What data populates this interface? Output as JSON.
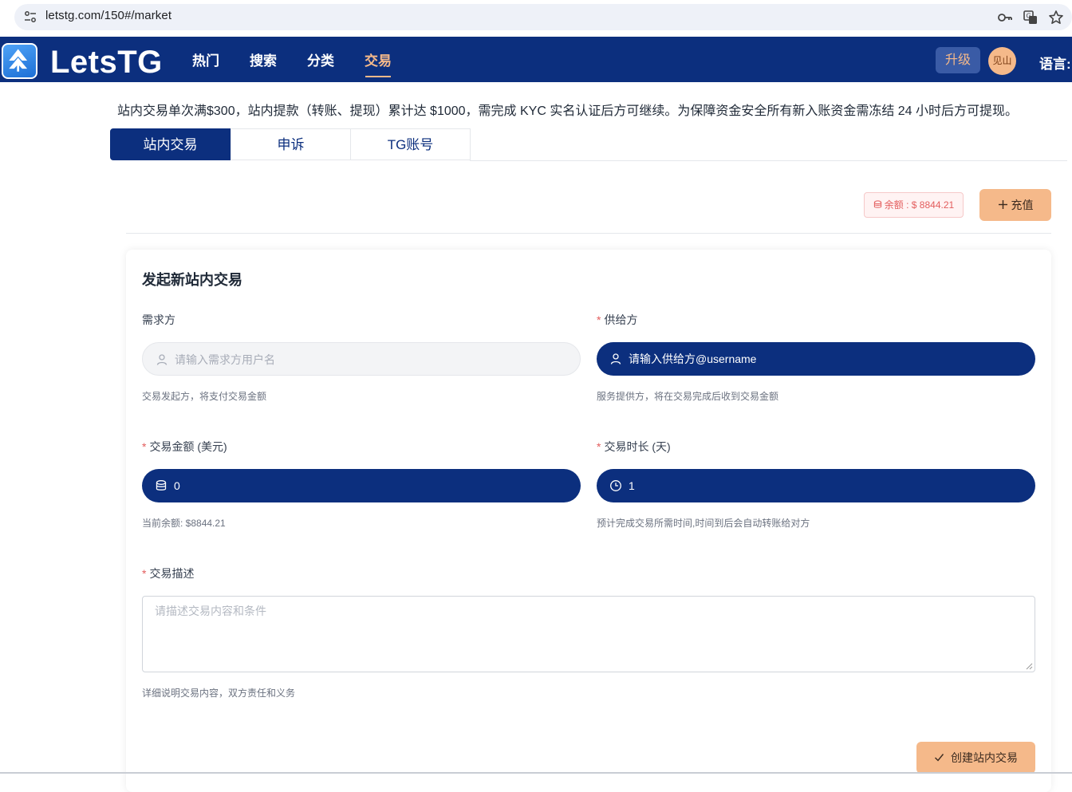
{
  "browser": {
    "url": "letstg.com/150#/market"
  },
  "header": {
    "logo_text": "LetsTG",
    "nav": [
      {
        "label": "热门"
      },
      {
        "label": "搜索"
      },
      {
        "label": "分类"
      },
      {
        "label": "交易"
      }
    ],
    "upgrade_label": "升级",
    "avatar_text": "见山",
    "language_label": "语言:"
  },
  "notice": "站内交易单次满$300，站内提款（转账、提现）累计达 $1000，需完成 KYC 实名认证后方可继续。为保障资金安全所有新入账资金需冻结 24 小时后方可提现。",
  "tabs": [
    {
      "label": "站内交易",
      "active": true
    },
    {
      "label": "申诉",
      "active": false
    },
    {
      "label": "TG账号",
      "active": false
    }
  ],
  "balance": {
    "label": "余额 : $ 8844.21"
  },
  "recharge_label": "充值",
  "form": {
    "title": "发起新站内交易",
    "buyer": {
      "label": "需求方",
      "placeholder": "请输入需求方用户名",
      "help": "交易发起方，将支付交易金额"
    },
    "seller": {
      "label": "供给方",
      "value": "请输入供给方@username",
      "help": "服务提供方，将在交易完成后收到交易金额"
    },
    "amount": {
      "label": "交易金额 (美元)",
      "value": "0",
      "help": "当前余额: $8844.21"
    },
    "duration": {
      "label": "交易时长 (天)",
      "value": "1",
      "help": "预计完成交易所需时间,时间到后会自动转账给对方"
    },
    "description": {
      "label": "交易描述",
      "placeholder": "请描述交易内容和条件",
      "help": "详细说明交易内容，双方责任和义务"
    },
    "submit_label": "创建站内交易"
  },
  "colors": {
    "primary": "#0c2f7e",
    "accent": "#f5b98a",
    "required": "#e35d5d"
  }
}
